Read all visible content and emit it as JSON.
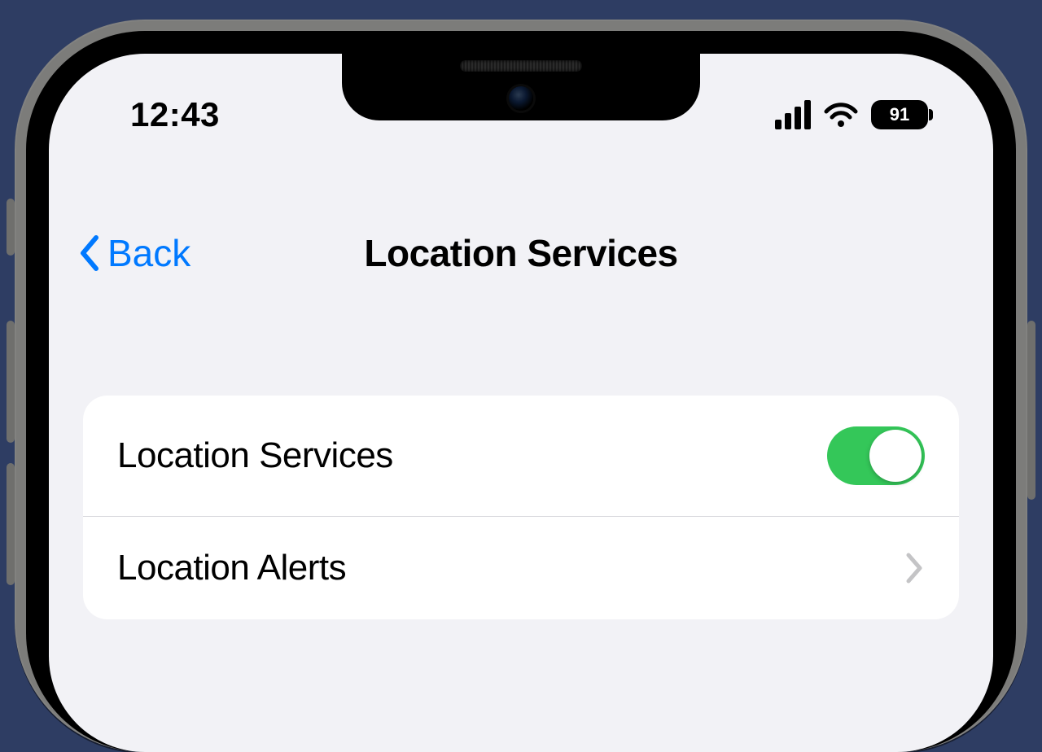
{
  "status": {
    "time": "12:43",
    "battery": "91"
  },
  "nav": {
    "back_label": "Back",
    "title": "Location Services"
  },
  "rows": {
    "location_services": {
      "label": "Location Services",
      "on": true
    },
    "location_alerts": {
      "label": "Location Alerts"
    }
  },
  "colors": {
    "accent": "#0079ff",
    "toggle_on": "#34c759",
    "bg": "#f2f2f6"
  }
}
